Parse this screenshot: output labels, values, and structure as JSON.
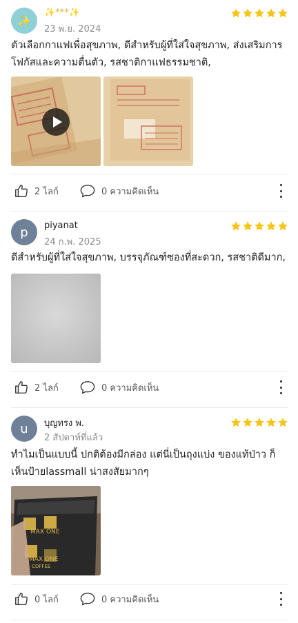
{
  "reviews": [
    {
      "user": "✨***✨",
      "date": "23 พ.ย. 2024",
      "avatar_letter": "✨",
      "rating": 5,
      "text": "ตัวเลือกกาแฟเพื่อสุขภาพ, ดีสำหรับผู้ที่ใส่ใจสุขภาพ, ส่งเสริมการโฟกัสและความตื่นตัว, รสชาติกาแฟธรรมชาติ,",
      "likes_label": "2 ไลก์",
      "comments_label": "0 ความคิดเห็น"
    },
    {
      "user": "piyanat",
      "date": "24 ก.พ. 2025",
      "avatar_letter": "p",
      "rating": 5,
      "text": "ดีสำหรับผู้ที่ใส่ใจสุขภาพ, บรรจุภัณฑ์ซองที่สะดวก, รสชาติดีมาก,",
      "likes_label": "2 ไลก์",
      "comments_label": "0 ความคิดเห็น"
    },
    {
      "user": "บุญทรง พ.",
      "date": "2 สัปดาห์ที่แล้ว",
      "avatar_letter": "u",
      "rating": 5,
      "text": "ทำไมเป็นแบบนี้ ปกติต้องมีกล่อง แต่นี่เป็นถุงแบ่ง ของแท้ป่าว ก็เห็นป้ายlassmall น่าสงสัยมากๆ",
      "likes_label": "0 ไลก์",
      "comments_label": "0 ความคิดเห็น",
      "product_brand": "MAX ONE",
      "product_sub": "COFFEE"
    }
  ],
  "colors": {
    "star": "#f5c518",
    "avatar_teal": "#8fcfd6",
    "avatar_slate": "#6f8198"
  },
  "icons": [
    "thumbs-up-icon",
    "comment-bubble-icon",
    "more-vertical-icon",
    "play-icon",
    "star-icon"
  ]
}
